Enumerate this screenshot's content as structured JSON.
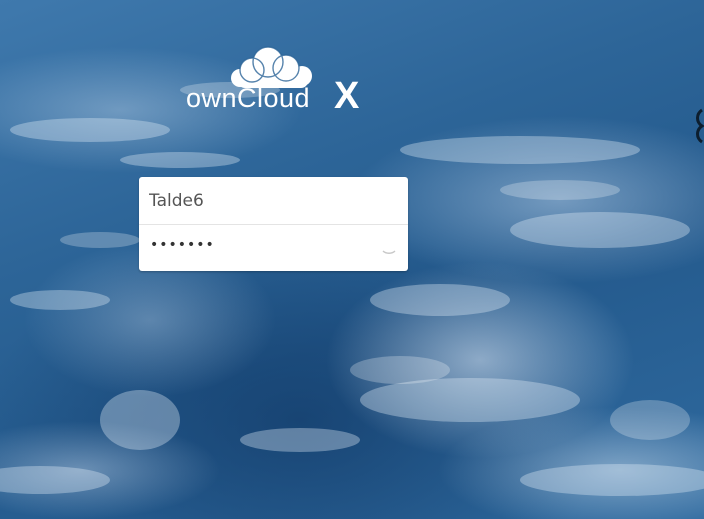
{
  "brand": {
    "name": "ownCloud",
    "badge": "X"
  },
  "login": {
    "username_value": "Talde6",
    "password_mask": "•••••••",
    "password_toggle_icon": "eye-icon"
  },
  "colors": {
    "background_base": "#2d6598",
    "form_background": "#ffffff",
    "text": "#555555"
  }
}
